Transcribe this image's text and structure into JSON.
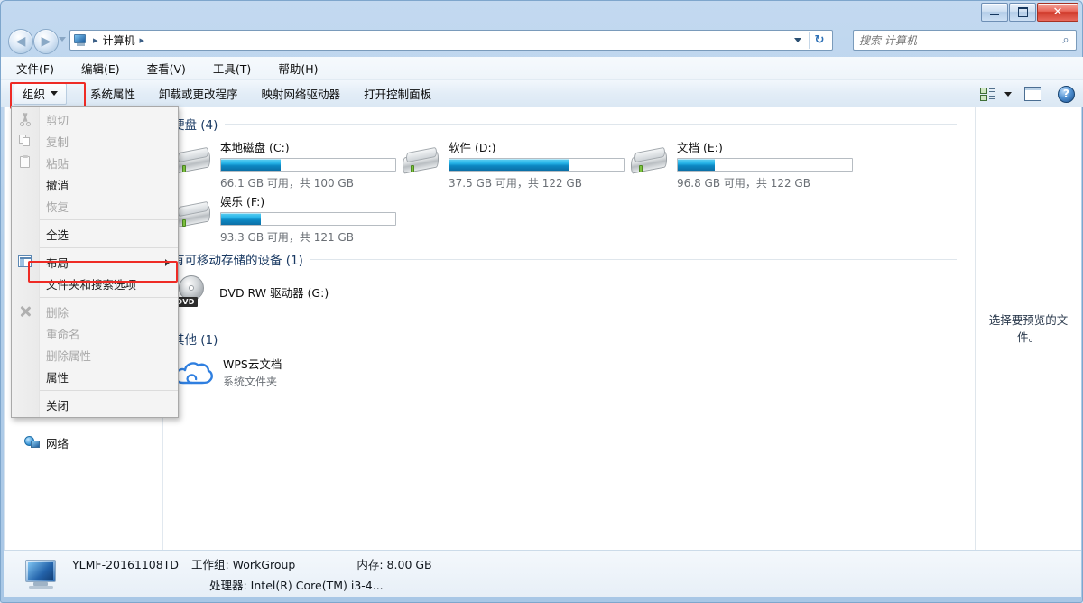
{
  "window": {
    "minimize_label": "最小化",
    "maximize_label": "还原",
    "close_label": "关闭",
    "close_glyph": "✕"
  },
  "nav": {
    "back_label": "后退",
    "forward_label": "前进",
    "back_glyph": "◀",
    "forward_glyph": "▶",
    "refresh_glyph": "↻",
    "breadcrumbs": [
      "计算机"
    ],
    "crumb_sep": "▸"
  },
  "search": {
    "placeholder": "搜索 计算机",
    "value": "",
    "icon_glyph": "⌕"
  },
  "menubar": {
    "items": [
      {
        "label": "文件(F)"
      },
      {
        "label": "编辑(E)"
      },
      {
        "label": "查看(V)"
      },
      {
        "label": "工具(T)"
      },
      {
        "label": "帮助(H)"
      }
    ]
  },
  "toolbar": {
    "organize_label": "组织",
    "items": [
      {
        "label": "系统属性"
      },
      {
        "label": "卸载或更改程序"
      },
      {
        "label": "映射网络驱动器"
      },
      {
        "label": "打开控制面板"
      }
    ],
    "help_glyph": "?"
  },
  "organize_menu": {
    "items": [
      {
        "label": "剪切",
        "state": "disabled",
        "icon": "scissors-icon"
      },
      {
        "label": "复制",
        "state": "disabled",
        "icon": "copy-icon"
      },
      {
        "label": "粘贴",
        "state": "disabled",
        "icon": "paste-icon"
      },
      {
        "label": "撤消",
        "state": "enabled",
        "icon": ""
      },
      {
        "label": "恢复",
        "state": "disabled",
        "icon": ""
      },
      {
        "label": "全选",
        "state": "enabled",
        "icon": ""
      },
      {
        "label": "布局",
        "state": "enabled",
        "icon": "layout-icon",
        "submenu": true
      },
      {
        "label": "文件夹和搜索选项",
        "state": "enabled",
        "icon": "",
        "highlighted": true
      },
      {
        "label": "删除",
        "state": "disabled",
        "icon": "delete-x-icon"
      },
      {
        "label": "重命名",
        "state": "disabled",
        "icon": ""
      },
      {
        "label": "删除属性",
        "state": "disabled",
        "icon": ""
      },
      {
        "label": "属性",
        "state": "enabled",
        "icon": ""
      },
      {
        "label": "关闭",
        "state": "enabled",
        "icon": ""
      }
    ]
  },
  "sidebar": {
    "items": [
      {
        "label": "WPS云文档",
        "icon": "cloud-icon"
      },
      {
        "label": "网络",
        "icon": "network-icon"
      }
    ]
  },
  "content": {
    "groups": [
      {
        "title": "硬盘 (4)"
      },
      {
        "title": "有可移动存储的设备 (1)"
      },
      {
        "title": "其他 (1)"
      }
    ],
    "drives": [
      {
        "name": "本地磁盘 (C:)",
        "free_text": "66.1 GB 可用，共 100 GB",
        "free_gb": 66.1,
        "total_gb": 100,
        "used_percent": 34
      },
      {
        "name": "软件 (D:)",
        "free_text": "37.5 GB 可用，共 122 GB",
        "free_gb": 37.5,
        "total_gb": 122,
        "used_percent": 69
      },
      {
        "name": "文档 (E:)",
        "free_text": "96.8 GB 可用，共 122 GB",
        "free_gb": 96.8,
        "total_gb": 122,
        "used_percent": 21
      },
      {
        "name": "娱乐 (F:)",
        "free_text": "93.3 GB 可用，共 121 GB",
        "free_gb": 93.3,
        "total_gb": 121,
        "used_percent": 23
      }
    ],
    "removable": [
      {
        "name": "DVD RW 驱动器 (G:)",
        "icon_label": "DVD"
      }
    ],
    "other": [
      {
        "name": "WPS云文档",
        "subtitle": "系统文件夹",
        "icon": "cloud-icon"
      }
    ]
  },
  "preview": {
    "text": "选择要预览的文件。"
  },
  "details": {
    "computer_name": "YLMF-20161108TD",
    "workgroup": "工作组: WorkGroup",
    "memory": "内存: 8.00 GB",
    "processor": "处理器: Intel(R) Core(TM) i3-4..."
  },
  "colors": {
    "accent_blue": "#1b8fc9",
    "highlight_red": "#ee2b25",
    "group_title": "#1a3a63"
  }
}
